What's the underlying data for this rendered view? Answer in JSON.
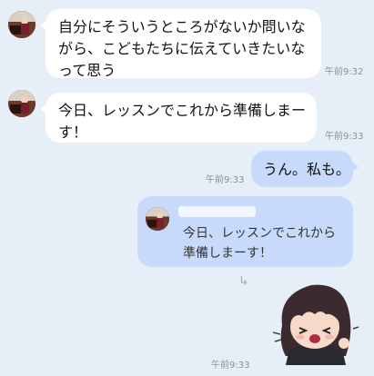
{
  "messages": [
    {
      "text": "自分にそういうところがないか問いながら、こどもたちに伝えていきたいなって思う",
      "time": "午前9:32"
    },
    {
      "text": "今日、レッスンでこれから準備しまーす！",
      "time": "午前9:33"
    }
  ],
  "my_message": {
    "text": "うん。私も。",
    "time": "午前9:33"
  },
  "reply": {
    "quoted_text": "今日、レッスンでこれから準備しまーす！",
    "time": "午前9:33"
  },
  "colors": {
    "background": "#e6eef7",
    "incoming_bubble": "#ffffff",
    "outgoing_bubble": "#c8dafc"
  }
}
